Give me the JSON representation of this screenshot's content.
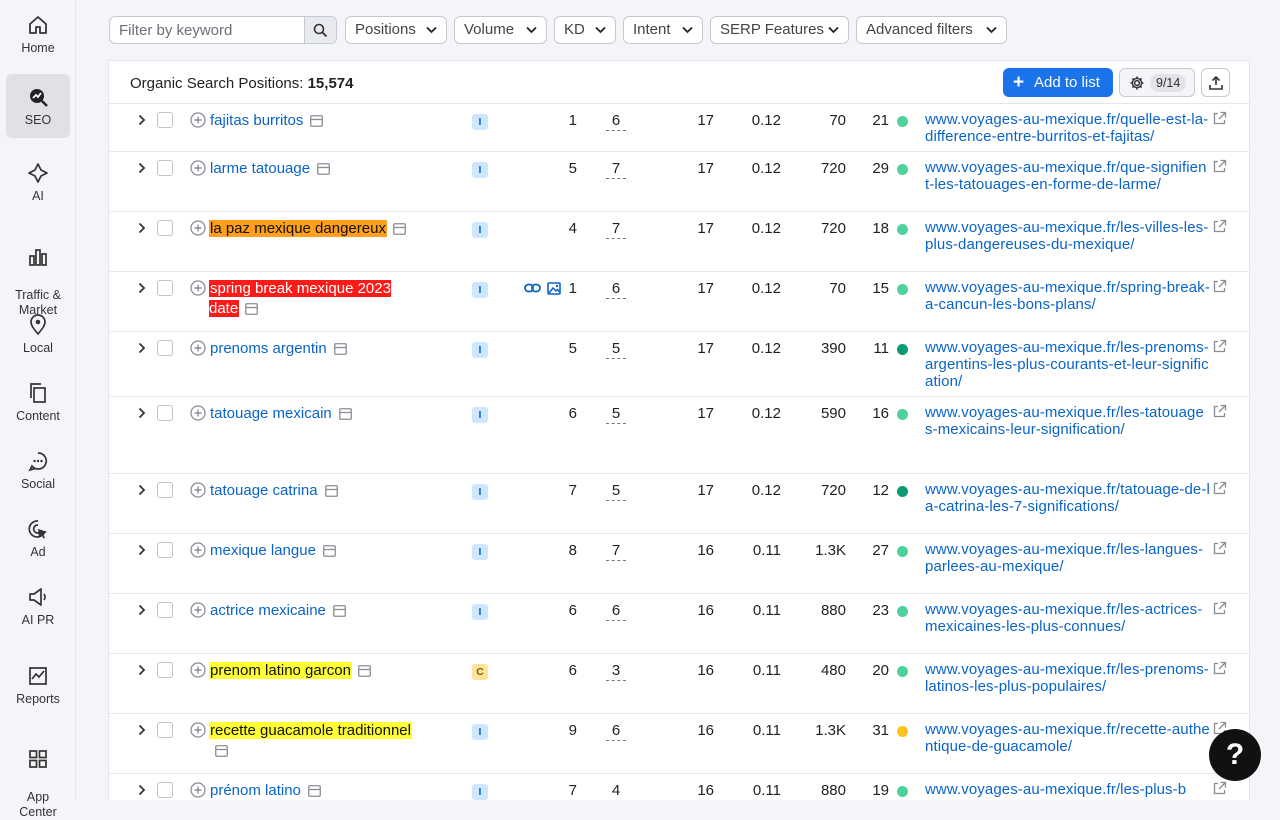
{
  "sidebar": {
    "items": [
      {
        "label": "Home",
        "icon": "home-icon"
      },
      {
        "label": "SEO",
        "icon": "seo-icon",
        "active": true
      },
      {
        "label": "AI",
        "icon": "ai-icon"
      },
      {
        "label": "Traffic &\nMarket",
        "icon": "traffic-icon"
      },
      {
        "label": "Local",
        "icon": "location-pin-icon"
      },
      {
        "label": "Content",
        "icon": "content-icon"
      },
      {
        "label": "Social",
        "icon": "social-chat-icon"
      },
      {
        "label": "Ad",
        "icon": "ad-cursor-icon"
      },
      {
        "label": "AI PR",
        "icon": "megaphone-icon"
      },
      {
        "label": "Reports",
        "icon": "reports-chart-icon"
      },
      {
        "label": "App\nCenter",
        "icon": "app-grid-icon"
      }
    ]
  },
  "filters": {
    "search_placeholder": "Filter by keyword",
    "dropdowns": [
      "Positions",
      "Volume",
      "KD",
      "Intent",
      "SERP Features",
      "Advanced filters"
    ]
  },
  "header": {
    "title_prefix": "Organic Search Positions:",
    "count": "15,574",
    "add_to_list": "Add to list",
    "columns_count": "9/14"
  },
  "colors": {
    "accent": "#1a73e8",
    "link": "#0a64c8",
    "highlight_orange": "#ff9f1c",
    "highlight_red": "#ff1a1a",
    "highlight_yellow": "#ffff33",
    "intent_informational_bg": "#cce7ff",
    "intent_informational_fg": "#0a64c8",
    "intent_commercial_bg": "#ffe39a",
    "intent_commercial_fg": "#8a5a00",
    "kd_light_green": "#4fd19b",
    "kd_dark_green": "#0e9a72",
    "kd_yellow": "#ffc21a"
  },
  "rows": [
    {
      "keyword": "fajitas burritos",
      "hl": "",
      "intent": "I",
      "features": [],
      "position": "1",
      "diff": "6",
      "traffic": "17",
      "traffic_pct": "0.12",
      "volume": "70",
      "kd": "21",
      "kd_color": "#4fd19b",
      "url": "www.voyages-au-mexique.fr/quelle-est-la-difference-entre-burritos-et-fajitas/"
    },
    {
      "keyword": "larme tatouage",
      "hl": "",
      "intent": "I",
      "features": [],
      "position": "5",
      "diff": "7",
      "traffic": "17",
      "traffic_pct": "0.12",
      "volume": "720",
      "kd": "29",
      "kd_color": "#4fd19b",
      "url": "www.voyages-au-mexique.fr/que-signifient-les-tatouages-en-forme-de-larme/"
    },
    {
      "keyword": "la paz mexique dangereux",
      "hl": "#ff9f1c",
      "intent": "I",
      "features": [],
      "position": "4",
      "diff": "7",
      "traffic": "17",
      "traffic_pct": "0.12",
      "volume": "720",
      "kd": "18",
      "kd_color": "#4fd19b",
      "url": "www.voyages-au-mexique.fr/les-villes-les-plus-dangereuses-du-mexique/"
    },
    {
      "keyword": "spring break mexique 2023 date",
      "hl": "#ff1a1a",
      "hl_text": "#ffffff",
      "intent": "I",
      "features": [
        "link-icon",
        "image-icon"
      ],
      "position": "1",
      "diff": "6",
      "traffic": "17",
      "traffic_pct": "0.12",
      "volume": "70",
      "kd": "15",
      "kd_color": "#4fd19b",
      "url": "www.voyages-au-mexique.fr/spring-break-a-cancun-les-bons-plans/"
    },
    {
      "keyword": "prenoms argentin",
      "hl": "",
      "intent": "I",
      "features": [],
      "position": "5",
      "diff": "5",
      "traffic": "17",
      "traffic_pct": "0.12",
      "volume": "390",
      "kd": "11",
      "kd_color": "#0e9a72",
      "url": "www.voyages-au-mexique.fr/les-prenoms-argentins-les-plus-courants-et-leur-signification/"
    },
    {
      "keyword": "tatouage mexicain",
      "hl": "",
      "intent": "I",
      "features": [],
      "position": "6",
      "diff": "5",
      "traffic": "17",
      "traffic_pct": "0.12",
      "volume": "590",
      "kd": "16",
      "kd_color": "#4fd19b",
      "url": "www.voyages-au-mexique.fr/les-tatouages-mexicains-leur-signification/"
    },
    {
      "keyword": "tatouage catrina",
      "hl": "",
      "intent": "I",
      "features": [],
      "position": "7",
      "diff": "5",
      "traffic": "17",
      "traffic_pct": "0.12",
      "volume": "720",
      "kd": "12",
      "kd_color": "#0e9a72",
      "url": "www.voyages-au-mexique.fr/tatouage-de-la-catrina-les-7-significations/"
    },
    {
      "keyword": "mexique langue",
      "hl": "",
      "intent": "I",
      "features": [],
      "position": "8",
      "diff": "7",
      "traffic": "16",
      "traffic_pct": "0.11",
      "volume": "1.3K",
      "kd": "27",
      "kd_color": "#4fd19b",
      "url": "www.voyages-au-mexique.fr/les-langues-parlees-au-mexique/"
    },
    {
      "keyword": "actrice mexicaine",
      "hl": "",
      "intent": "I",
      "features": [],
      "position": "6",
      "diff": "6",
      "traffic": "16",
      "traffic_pct": "0.11",
      "volume": "880",
      "kd": "23",
      "kd_color": "#4fd19b",
      "url": "www.voyages-au-mexique.fr/les-actrices-mexicaines-les-plus-connues/"
    },
    {
      "keyword": "prenom latino garcon",
      "hl": "#ffff33",
      "intent": "C",
      "features": [],
      "position": "6",
      "diff": "3",
      "traffic": "16",
      "traffic_pct": "0.11",
      "volume": "480",
      "kd": "20",
      "kd_color": "#4fd19b",
      "url": "www.voyages-au-mexique.fr/les-prenoms-latinos-les-plus-populaires/"
    },
    {
      "keyword": "recette guacamole traditionnel",
      "hl": "#ffff33",
      "intent": "I",
      "features": [],
      "position": "9",
      "diff": "6",
      "traffic": "16",
      "traffic_pct": "0.11",
      "volume": "1.3K",
      "kd": "31",
      "kd_color": "#ffc21a",
      "url": "www.voyages-au-mexique.fr/recette-authentique-de-guacamole/"
    },
    {
      "keyword": "prénom latino",
      "hl": "",
      "intent": "I",
      "features": [],
      "position": "7",
      "diff": "4",
      "traffic": "16",
      "traffic_pct": "0.11",
      "volume": "880",
      "kd": "19",
      "kd_color": "#4fd19b",
      "url": "www.voyages-au-mexique.fr/les-plus-b"
    }
  ],
  "help_label": "?"
}
